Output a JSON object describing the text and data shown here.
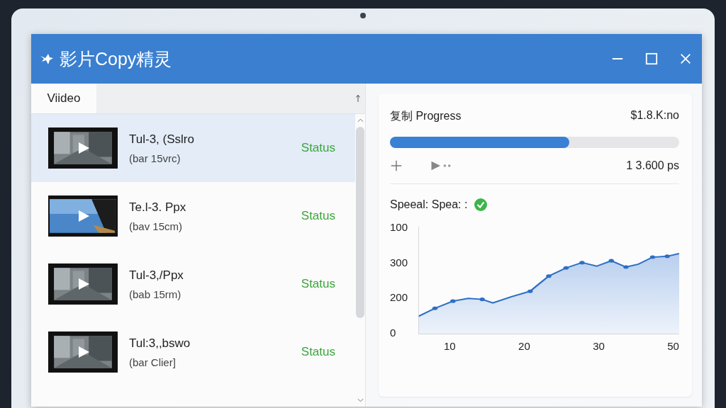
{
  "window": {
    "title": "影片Copy精灵"
  },
  "tabs": [
    {
      "label": "Viideo",
      "selected": true
    }
  ],
  "videos": [
    {
      "title": "Tul-3, (Sslro",
      "subtitle": "(bar 15vrc)",
      "status": "Status",
      "selected": true
    },
    {
      "title": "Te.l-3. Ppx",
      "subtitle": "(bav 15cm)",
      "status": "Status",
      "selected": false
    },
    {
      "title": "Tul-3,/Ppx",
      "subtitle": "(bab 15rm)",
      "status": "Status",
      "selected": false
    },
    {
      "title": "Tul:3,,bswo",
      "subtitle": "(bar Clier]",
      "status": "Status",
      "selected": false
    }
  ],
  "progress": {
    "label": "复制 Progress",
    "value": "$1.8.K:no",
    "level": 0.62,
    "rate": "1 3.600 ps"
  },
  "speed": {
    "title": "Speeal: Spea: :",
    "y_labels": [
      "100",
      "300",
      "200",
      "0"
    ],
    "x_labels": [
      "10",
      "20",
      "30",
      "50"
    ]
  }
}
